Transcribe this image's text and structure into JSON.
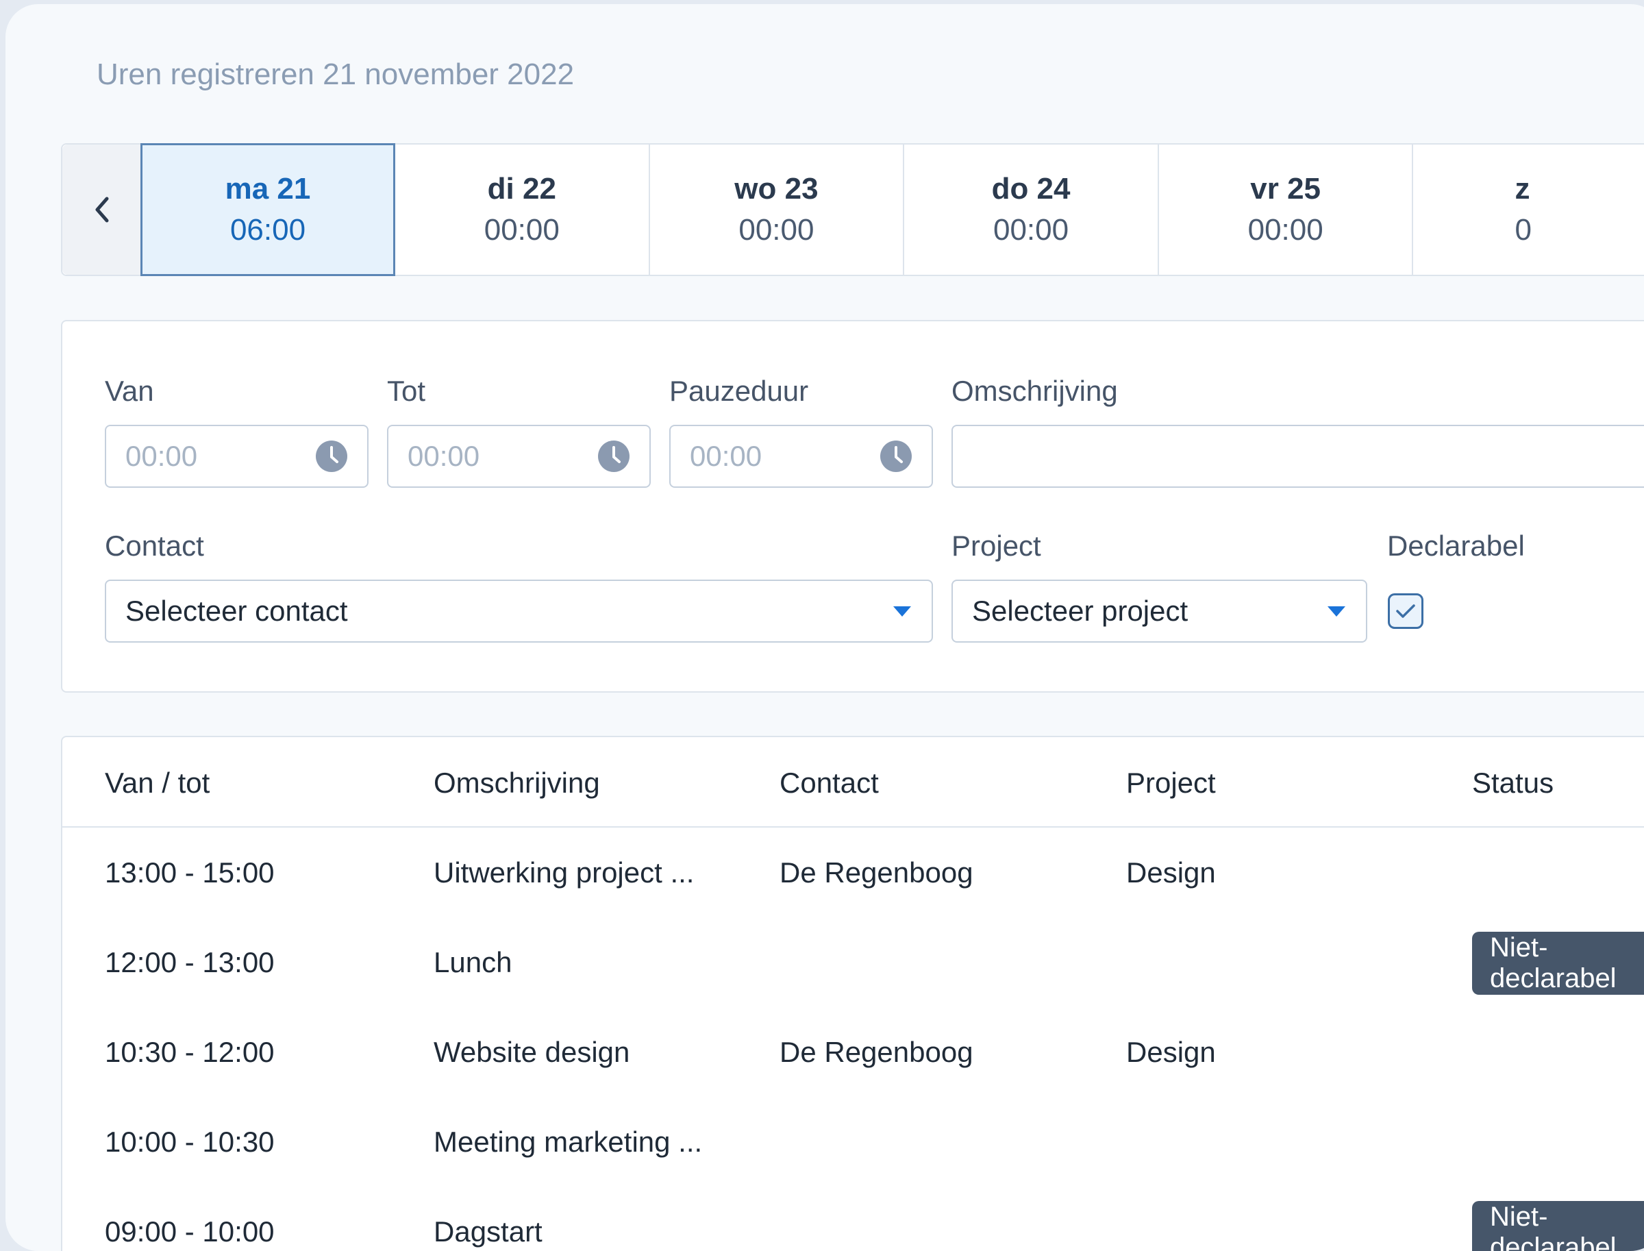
{
  "page_title": "Uren registreren 21 november 2022",
  "day_nav": {
    "prev_icon": "chevron-left-icon",
    "days": [
      {
        "name": "ma 21",
        "time": "06:00",
        "active": true
      },
      {
        "name": "di 22",
        "time": "00:00",
        "active": false
      },
      {
        "name": "wo 23",
        "time": "00:00",
        "active": false
      },
      {
        "name": "do 24",
        "time": "00:00",
        "active": false
      },
      {
        "name": "vr 25",
        "time": "00:00",
        "active": false
      },
      {
        "name": "z",
        "time": "0",
        "active": false
      }
    ]
  },
  "form": {
    "van_label": "Van",
    "van_placeholder": "00:00",
    "tot_label": "Tot",
    "tot_placeholder": "00:00",
    "pauze_label": "Pauzeduur",
    "pauze_placeholder": "00:00",
    "omschrijving_label": "Omschrijving",
    "omschrijving_value": "",
    "contact_label": "Contact",
    "contact_value": "Selecteer contact",
    "project_label": "Project",
    "project_value": "Selecteer project",
    "declarabel_label": "Declarabel",
    "declarabel_checked": true
  },
  "table": {
    "headers": {
      "van_tot": "Van / tot",
      "omschrijving": "Omschrijving",
      "contact": "Contact",
      "project": "Project",
      "status": "Status"
    },
    "rows": [
      {
        "van_tot": "13:00 - 15:00",
        "omschrijving": "Uitwerking project ...",
        "contact": "De Regenboog",
        "project": "Design",
        "status": ""
      },
      {
        "van_tot": "12:00 - 13:00",
        "omschrijving": "Lunch",
        "contact": "",
        "project": "",
        "status": "Niet-declarabel"
      },
      {
        "van_tot": "10:30 - 12:00",
        "omschrijving": "Website design",
        "contact": "De Regenboog",
        "project": "Design",
        "status": ""
      },
      {
        "van_tot": "10:00 - 10:30",
        "omschrijving": "Meeting marketing ...",
        "contact": "",
        "project": "",
        "status": ""
      },
      {
        "van_tot": "09:00 - 10:00",
        "omschrijving": "Dagstart",
        "contact": "",
        "project": "",
        "status": "Niet-declarabel"
      }
    ]
  },
  "colors": {
    "accent": "#1766b7",
    "active_day_bg": "#e6f2fc",
    "badge_bg": "#46566a",
    "caret": "#1a73d9",
    "clock": "#8b9ab0"
  }
}
